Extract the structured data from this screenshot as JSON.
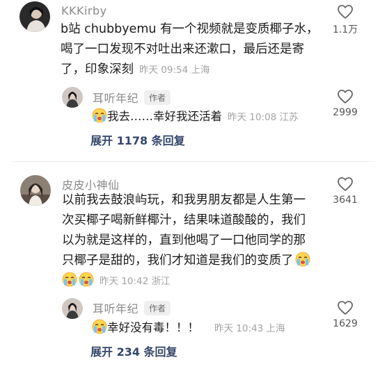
{
  "comments": [
    {
      "username": "KKKirby",
      "text_lines": [
        "b站 chubbyemu 有一个视频就是变质椰子水，",
        "喝了一口发现不对吐出来还漱口，最后还是寄",
        "了，印象深刻"
      ],
      "meta": "昨天 09:54 上海",
      "likes": "1.1万",
      "reply": {
        "username": "耳听年纪",
        "badge": "作者",
        "text": "我去……幸好我还活着",
        "meta": "昨天 10:08 江苏",
        "likes": "2999"
      },
      "expand": "展开 1178 条回复"
    },
    {
      "username": "皮皮小神仙",
      "text_lines": [
        "以前我去鼓浪屿玩，和我男朋友都是人生第一",
        "次买椰子喝新鲜椰汁，结果味道酸酸的，我们",
        "以为就是这样的，直到他喝了一口他同学的那",
        "只椰子是甜的，我们才知道是我们的变质了"
      ],
      "meta": "昨天 10:42 浙江",
      "likes": "3641",
      "reply": {
        "username": "耳听年纪",
        "badge": "作者",
        "text": "幸好没有毒！！！",
        "meta": "昨天 10:43 上海",
        "likes": "1629"
      },
      "expand": "展开 234 条回复"
    }
  ],
  "icons": {
    "like": "heart-outline-icon",
    "emoji": "crying-face-emoji-icon"
  },
  "colors": {
    "link": "#34466a",
    "muted": "#a3a3a3"
  }
}
